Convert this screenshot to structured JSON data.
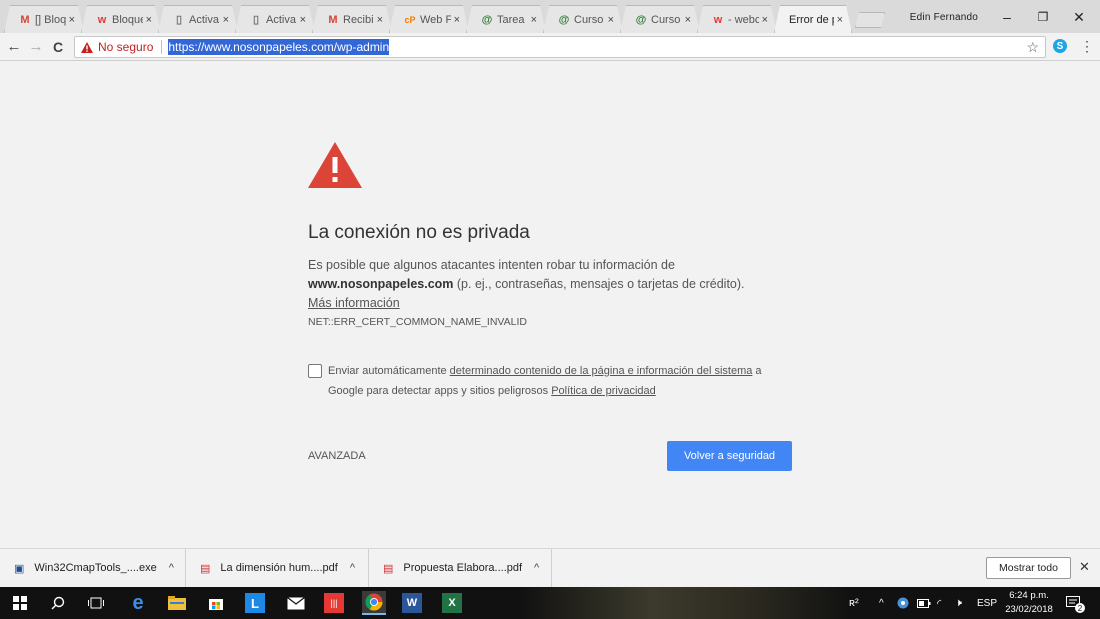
{
  "browser": {
    "tabs": [
      {
        "icon": "gmail-icon",
        "icon_glyph": "M",
        "icon_color": "#d44638",
        "title": "[] Bloq"
      },
      {
        "icon": "w-icon",
        "icon_glyph": "w",
        "icon_color": "#e53935",
        "title": "Bloque"
      },
      {
        "icon": "document-icon",
        "icon_glyph": "▯",
        "icon_color": "#777777",
        "title": "Activa"
      },
      {
        "icon": "document-icon",
        "icon_glyph": "▯",
        "icon_color": "#777777",
        "title": "Activa"
      },
      {
        "icon": "gmail-icon",
        "icon_glyph": "M",
        "icon_color": "#d44638",
        "title": "Recibi"
      },
      {
        "icon": "cp-icon",
        "icon_glyph": "cP",
        "icon_color": "#f57c00",
        "title": "Web F"
      },
      {
        "icon": "at-icon",
        "icon_glyph": "@",
        "icon_color": "#2e7d32",
        "title": "Tarea"
      },
      {
        "icon": "at-icon",
        "icon_glyph": "@",
        "icon_color": "#2e7d32",
        "title": "Curso"
      },
      {
        "icon": "at-icon",
        "icon_glyph": "@",
        "icon_color": "#2e7d32",
        "title": "Curso"
      },
      {
        "icon": "w-icon",
        "icon_glyph": "w",
        "icon_color": "#e53935",
        "title": "- webc"
      },
      {
        "icon": "",
        "icon_glyph": "",
        "icon_color": "#777777",
        "title": "Error de pr",
        "active": true
      }
    ],
    "close_glyph": "×",
    "user_name": "Edin Fernando",
    "window_controls": {
      "minimize": "–",
      "restore": "❐",
      "close": "✕"
    }
  },
  "toolbar": {
    "back": "←",
    "forward": "→",
    "reload": "C",
    "security_label": "No seguro",
    "url": "https://www.nosonpapeles.com/wp-admin",
    "star": "☆",
    "ext_glyph": "S",
    "menu": "⋮"
  },
  "page": {
    "heading": "La conexión no es privada",
    "intro": "Es posible que algunos atacantes intenten robar tu información de",
    "domain": "www.nosonpapeles.com",
    "intro_rest": " (p. ej., contraseñas, mensajes o tarjetas de crédito). ",
    "more_info_link": "Más información",
    "error_code": "NET::ERR_CERT_COMMON_NAME_INVALID",
    "checkbox_prefix": "Enviar automáticamente ",
    "checkbox_link": "determinado contenido de la página e información del sistema",
    "checkbox_middle": " a Google para detectar apps y sitios peligrosos ",
    "privacy_link": "Política de privacidad",
    "advanced_label": "AVANZADA",
    "back_to_safety_label": "Volver a seguridad"
  },
  "downloads": {
    "items": [
      {
        "icon": "installer-icon",
        "icon_glyph": "▣",
        "icon_color": "#1e4e8c",
        "name": "Win32CmapTools_....exe"
      },
      {
        "icon": "pdf-icon",
        "icon_glyph": "⅌",
        "icon_color": "#d32f2f",
        "name": "La dimensión hum....pdf"
      },
      {
        "icon": "pdf-icon",
        "icon_glyph": "⅌",
        "icon_color": "#d32f2f",
        "name": "Propuesta Elabora....pdf"
      }
    ],
    "chevron": "^",
    "show_all_label": "Mostrar todo",
    "close": "✕"
  },
  "taskbar": {
    "language": "ESP",
    "time": "6:24 p.m.",
    "date": "23/02/2018",
    "notification_count": "2"
  }
}
